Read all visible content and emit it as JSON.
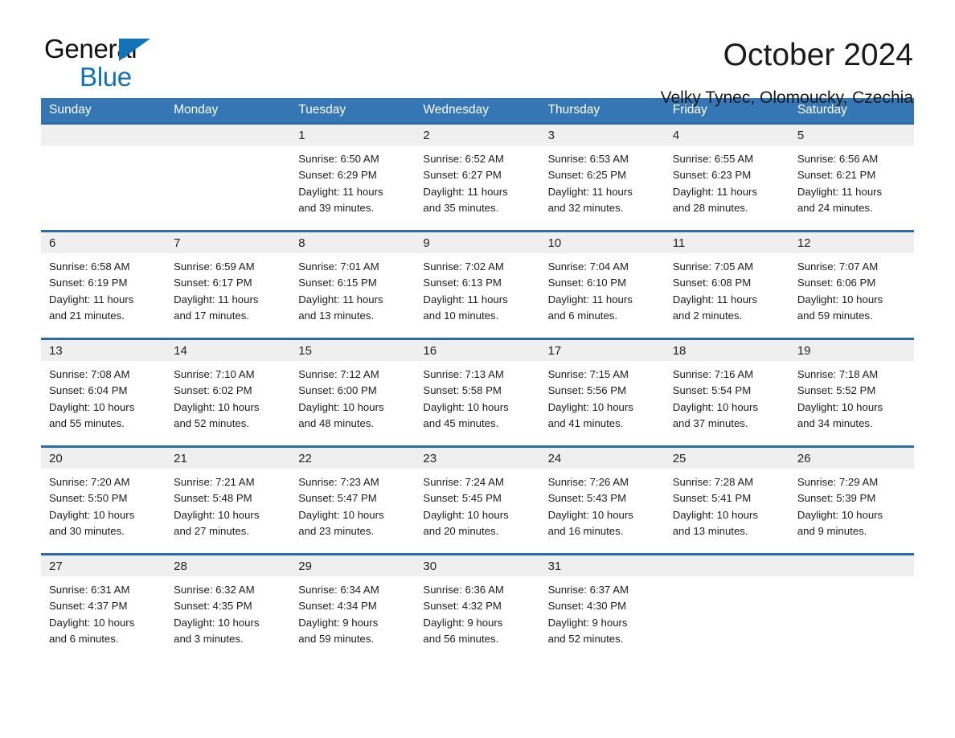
{
  "brand": {
    "name_top": "General",
    "name_bottom": "Blue",
    "accent_color": "#1272b8",
    "triangle_icon": "brand-triangle-icon"
  },
  "header": {
    "title": "October 2024",
    "location": "Velky Tynec, Olomoucky, Czechia"
  },
  "theme": {
    "header_blue": "#3576b5",
    "row_divider_blue": "#2e6ca8",
    "daynum_band": "#efefef",
    "text": "#1c1c1c"
  },
  "weekdays": [
    "Sunday",
    "Monday",
    "Tuesday",
    "Wednesday",
    "Thursday",
    "Friday",
    "Saturday"
  ],
  "weeks": [
    [
      {
        "day": "",
        "info": ""
      },
      {
        "day": "",
        "info": ""
      },
      {
        "day": "1",
        "info": "Sunrise: 6:50 AM\nSunset: 6:29 PM\nDaylight: 11 hours\nand 39 minutes."
      },
      {
        "day": "2",
        "info": "Sunrise: 6:52 AM\nSunset: 6:27 PM\nDaylight: 11 hours\nand 35 minutes."
      },
      {
        "day": "3",
        "info": "Sunrise: 6:53 AM\nSunset: 6:25 PM\nDaylight: 11 hours\nand 32 minutes."
      },
      {
        "day": "4",
        "info": "Sunrise: 6:55 AM\nSunset: 6:23 PM\nDaylight: 11 hours\nand 28 minutes."
      },
      {
        "day": "5",
        "info": "Sunrise: 6:56 AM\nSunset: 6:21 PM\nDaylight: 11 hours\nand 24 minutes."
      }
    ],
    [
      {
        "day": "6",
        "info": "Sunrise: 6:58 AM\nSunset: 6:19 PM\nDaylight: 11 hours\nand 21 minutes."
      },
      {
        "day": "7",
        "info": "Sunrise: 6:59 AM\nSunset: 6:17 PM\nDaylight: 11 hours\nand 17 minutes."
      },
      {
        "day": "8",
        "info": "Sunrise: 7:01 AM\nSunset: 6:15 PM\nDaylight: 11 hours\nand 13 minutes."
      },
      {
        "day": "9",
        "info": "Sunrise: 7:02 AM\nSunset: 6:13 PM\nDaylight: 11 hours\nand 10 minutes."
      },
      {
        "day": "10",
        "info": "Sunrise: 7:04 AM\nSunset: 6:10 PM\nDaylight: 11 hours\nand 6 minutes."
      },
      {
        "day": "11",
        "info": "Sunrise: 7:05 AM\nSunset: 6:08 PM\nDaylight: 11 hours\nand 2 minutes."
      },
      {
        "day": "12",
        "info": "Sunrise: 7:07 AM\nSunset: 6:06 PM\nDaylight: 10 hours\nand 59 minutes."
      }
    ],
    [
      {
        "day": "13",
        "info": "Sunrise: 7:08 AM\nSunset: 6:04 PM\nDaylight: 10 hours\nand 55 minutes."
      },
      {
        "day": "14",
        "info": "Sunrise: 7:10 AM\nSunset: 6:02 PM\nDaylight: 10 hours\nand 52 minutes."
      },
      {
        "day": "15",
        "info": "Sunrise: 7:12 AM\nSunset: 6:00 PM\nDaylight: 10 hours\nand 48 minutes."
      },
      {
        "day": "16",
        "info": "Sunrise: 7:13 AM\nSunset: 5:58 PM\nDaylight: 10 hours\nand 45 minutes."
      },
      {
        "day": "17",
        "info": "Sunrise: 7:15 AM\nSunset: 5:56 PM\nDaylight: 10 hours\nand 41 minutes."
      },
      {
        "day": "18",
        "info": "Sunrise: 7:16 AM\nSunset: 5:54 PM\nDaylight: 10 hours\nand 37 minutes."
      },
      {
        "day": "19",
        "info": "Sunrise: 7:18 AM\nSunset: 5:52 PM\nDaylight: 10 hours\nand 34 minutes."
      }
    ],
    [
      {
        "day": "20",
        "info": "Sunrise: 7:20 AM\nSunset: 5:50 PM\nDaylight: 10 hours\nand 30 minutes."
      },
      {
        "day": "21",
        "info": "Sunrise: 7:21 AM\nSunset: 5:48 PM\nDaylight: 10 hours\nand 27 minutes."
      },
      {
        "day": "22",
        "info": "Sunrise: 7:23 AM\nSunset: 5:47 PM\nDaylight: 10 hours\nand 23 minutes."
      },
      {
        "day": "23",
        "info": "Sunrise: 7:24 AM\nSunset: 5:45 PM\nDaylight: 10 hours\nand 20 minutes."
      },
      {
        "day": "24",
        "info": "Sunrise: 7:26 AM\nSunset: 5:43 PM\nDaylight: 10 hours\nand 16 minutes."
      },
      {
        "day": "25",
        "info": "Sunrise: 7:28 AM\nSunset: 5:41 PM\nDaylight: 10 hours\nand 13 minutes."
      },
      {
        "day": "26",
        "info": "Sunrise: 7:29 AM\nSunset: 5:39 PM\nDaylight: 10 hours\nand 9 minutes."
      }
    ],
    [
      {
        "day": "27",
        "info": "Sunrise: 6:31 AM\nSunset: 4:37 PM\nDaylight: 10 hours\nand 6 minutes."
      },
      {
        "day": "28",
        "info": "Sunrise: 6:32 AM\nSunset: 4:35 PM\nDaylight: 10 hours\nand 3 minutes."
      },
      {
        "day": "29",
        "info": "Sunrise: 6:34 AM\nSunset: 4:34 PM\nDaylight: 9 hours\nand 59 minutes."
      },
      {
        "day": "30",
        "info": "Sunrise: 6:36 AM\nSunset: 4:32 PM\nDaylight: 9 hours\nand 56 minutes."
      },
      {
        "day": "31",
        "info": "Sunrise: 6:37 AM\nSunset: 4:30 PM\nDaylight: 9 hours\nand 52 minutes."
      },
      {
        "day": "",
        "info": ""
      },
      {
        "day": "",
        "info": ""
      }
    ]
  ]
}
